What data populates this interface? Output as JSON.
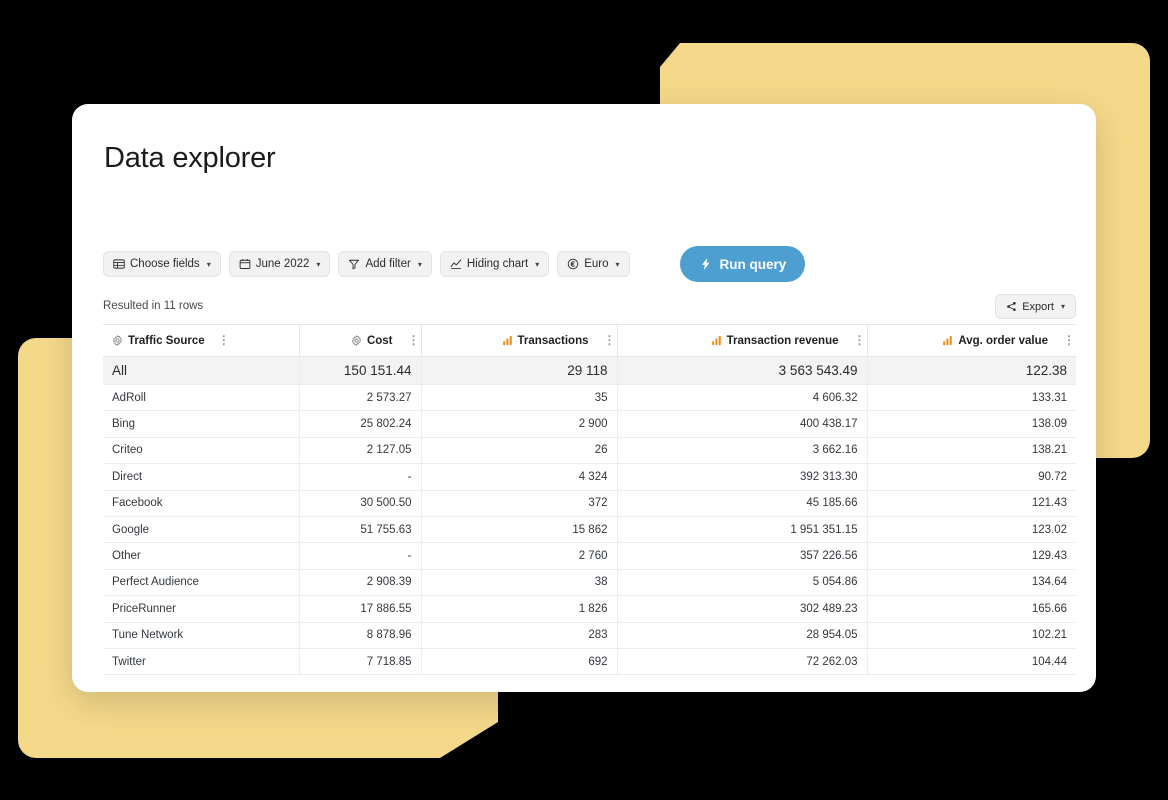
{
  "page": {
    "title": "Data explorer"
  },
  "toolbar": {
    "buttons": [
      {
        "label": "Choose fields",
        "icon": "table-grid-icon",
        "caret": "▾"
      },
      {
        "label": "June 2022",
        "icon": "calendar-icon",
        "caret": "▾"
      },
      {
        "label": "Add filter",
        "icon": "filter-funnel-icon",
        "caret": "▾"
      },
      {
        "label": "Hiding chart",
        "icon": "line-chart-icon",
        "caret": "▾"
      },
      {
        "label": "Euro",
        "icon": "currency-circle-icon",
        "caret": "▾"
      }
    ],
    "run_query_label": "Run query",
    "run_query_icon": "lightning-bolt-icon",
    "run_query_color": "#4e9fd1"
  },
  "results": {
    "count_text": "Resulted in 11 rows",
    "export_label": "Export",
    "export_icon": "share-nodes-icon",
    "export_caret": "▾"
  },
  "table": {
    "kebab_glyph": "⋮",
    "columns": [
      {
        "label": "Traffic Source",
        "icon": "dimension-gear-icon",
        "icon_color": "#8a8a8a",
        "align": "left"
      },
      {
        "label": "Cost",
        "icon": "dimension-gear-icon",
        "icon_color": "#8a8a8a",
        "align": "right"
      },
      {
        "label": "Transactions",
        "icon": "metric-bar-icon",
        "icon_color": "#f08c1e",
        "align": "right"
      },
      {
        "label": "Transaction revenue",
        "icon": "metric-bar-icon",
        "icon_color": "#f08c1e",
        "align": "right"
      },
      {
        "label": "Avg. order value",
        "icon": "metric-bar-icon",
        "icon_color": "#f08c1e",
        "align": "right"
      }
    ],
    "rows": [
      {
        "total": true,
        "cells": [
          "All",
          "150 151.44",
          "29 118",
          "3 563 543.49",
          "122.38"
        ]
      },
      {
        "total": false,
        "cells": [
          "AdRoll",
          "2 573.27",
          "35",
          "4 606.32",
          "133.31"
        ]
      },
      {
        "total": false,
        "cells": [
          "Bing",
          "25 802.24",
          "2 900",
          "400 438.17",
          "138.09"
        ]
      },
      {
        "total": false,
        "cells": [
          "Criteo",
          "2 127.05",
          "26",
          "3 662.16",
          "138.21"
        ]
      },
      {
        "total": false,
        "cells": [
          "Direct",
          "-",
          "4 324",
          "392 313.30",
          "90.72"
        ]
      },
      {
        "total": false,
        "cells": [
          "Facebook",
          "30 500.50",
          "372",
          "45 185.66",
          "121.43"
        ]
      },
      {
        "total": false,
        "cells": [
          "Google",
          "51 755.63",
          "15 862",
          "1 951 351.15",
          "123.02"
        ]
      },
      {
        "total": false,
        "cells": [
          "Other",
          "-",
          "2 760",
          "357 226.56",
          "129.43"
        ]
      },
      {
        "total": false,
        "cells": [
          "Perfect Audience",
          "2 908.39",
          "38",
          "5 054.86",
          "134.64"
        ]
      },
      {
        "total": false,
        "cells": [
          "PriceRunner",
          "17 886.55",
          "1 826",
          "302 489.23",
          "165.66"
        ]
      },
      {
        "total": false,
        "cells": [
          "Tune Network",
          "8 878.96",
          "283",
          "28 954.05",
          "102.21"
        ]
      },
      {
        "total": false,
        "cells": [
          "Twitter",
          "7 718.85",
          "692",
          "72 262.03",
          "104.44"
        ]
      }
    ]
  },
  "decor": {
    "accent_yellow": "#f5d98a",
    "background": "#000000",
    "card_background": "#ffffff"
  }
}
